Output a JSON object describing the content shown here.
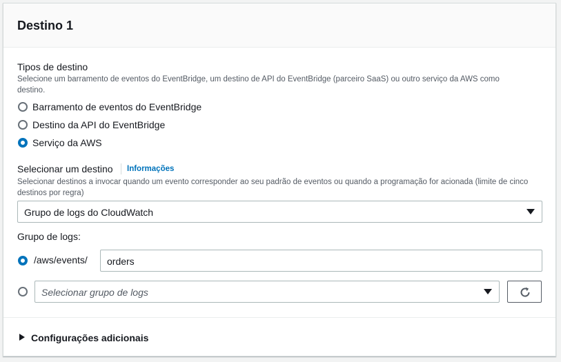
{
  "panel": {
    "title": "Destino 1"
  },
  "target_types": {
    "label": "Tipos de destino",
    "description": "Selecione um barramento de eventos do EventBridge, um destino de API do EventBridge (parceiro SaaS) ou outro serviço da AWS como destino.",
    "options": [
      {
        "label": "Barramento de eventos do EventBridge",
        "selected": false
      },
      {
        "label": "Destino da API do EventBridge",
        "selected": false
      },
      {
        "label": "Serviço da AWS",
        "selected": true
      }
    ]
  },
  "select_target": {
    "label": "Selecionar um destino",
    "info_link": "Informações",
    "description": "Selecionar destinos a invocar quando um evento corresponder ao seu padrão de eventos ou quando a programação for acionada (limite de cinco destinos por regra)",
    "selected_value": "Grupo de logs do CloudWatch"
  },
  "log_group": {
    "label": "Grupo de logs:",
    "prefix_option": {
      "prefix": "/aws/events/",
      "value": "orders",
      "selected": true
    },
    "existing_option": {
      "placeholder": "Selecionar grupo de logs",
      "selected": false
    },
    "refresh_icon": "refresh-icon"
  },
  "additional": {
    "label": "Configurações adicionais",
    "expanded": false
  },
  "colors": {
    "accent": "#0073bb",
    "text": "#16191f",
    "muted": "#545b64",
    "border": "#aab7b8"
  }
}
